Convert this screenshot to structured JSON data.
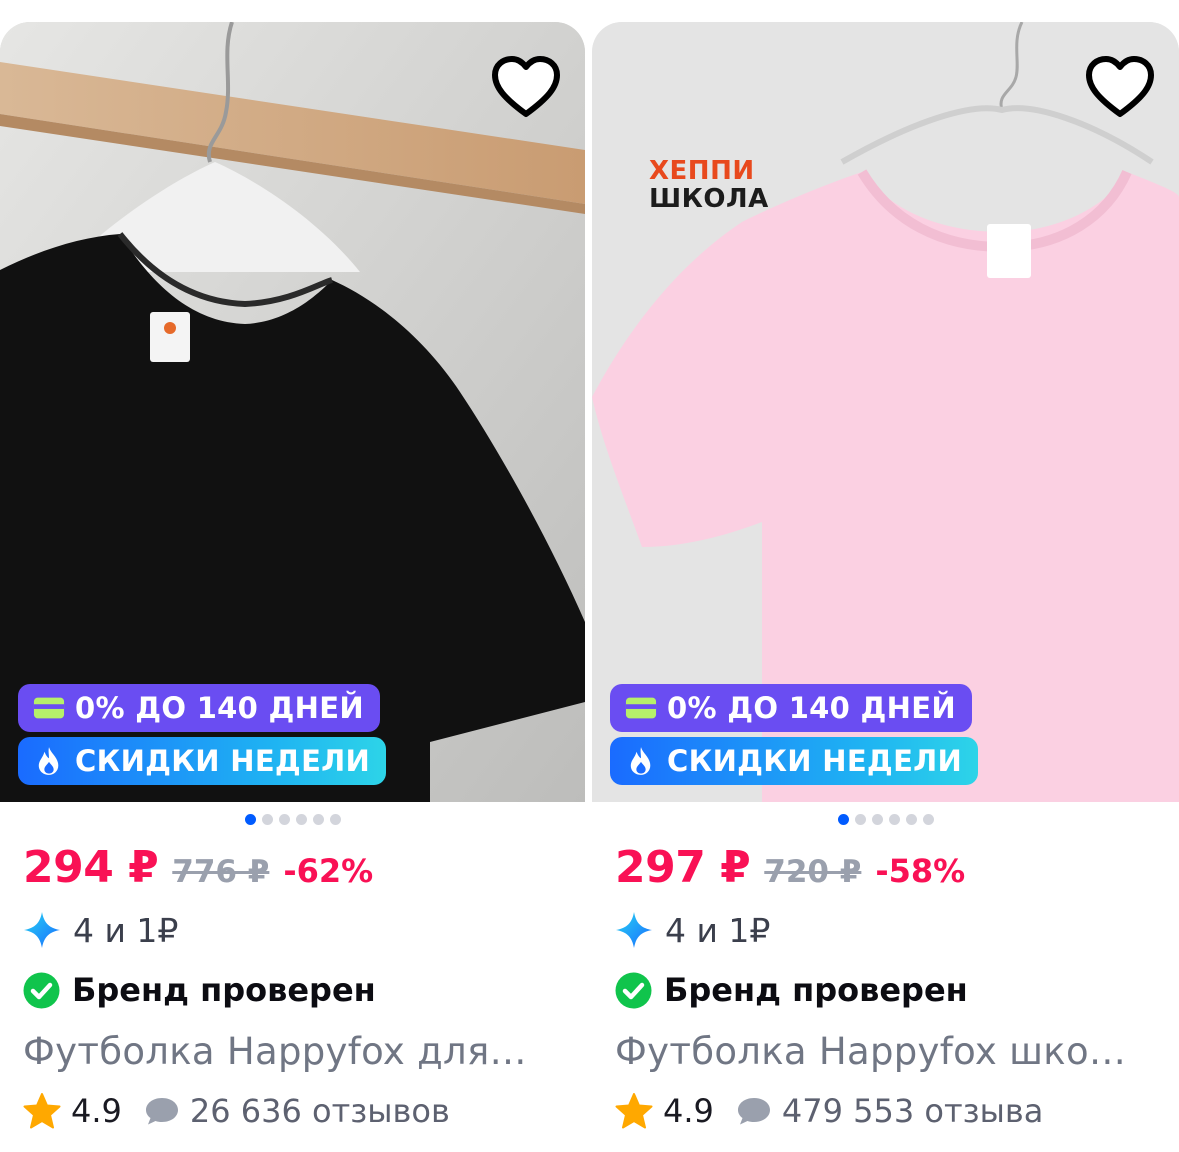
{
  "colors": {
    "price": "#f91155",
    "old_price": "#9aa0ad",
    "credit_badge": "#6a4df2",
    "sale_badge": "#1a6bff",
    "dot_active": "#005bff",
    "check": "#10c44c",
    "star": "#ffa800"
  },
  "products": [
    {
      "image_alt": "black t-shirt on hanger",
      "favorite_icon": "heart-outline-icon",
      "badges": {
        "credit": "0% ДО 140 ДНЕЙ",
        "sale": "СКИДКИ НЕДЕЛИ"
      },
      "gallery": {
        "total": 6,
        "active": 1
      },
      "price": {
        "current": "294 ₽",
        "old": "776 ₽",
        "discount": "-62%"
      },
      "bonus": "4 и 1₽",
      "brand_verified": "Бренд проверен",
      "title": "Футболка Happyfox для…",
      "rating": "4.9",
      "reviews": "26 636 отзывов"
    },
    {
      "image_alt": "pink t-shirt on hanger",
      "favorite_icon": "heart-outline-icon",
      "logo": {
        "line1": "ХЕППИ",
        "line2": "ШКОЛА"
      },
      "badges": {
        "credit": "0% ДО 140 ДНЕЙ",
        "sale": "СКИДКИ НЕДЕЛИ"
      },
      "gallery": {
        "total": 6,
        "active": 1
      },
      "price": {
        "current": "297 ₽",
        "old": "720 ₽",
        "discount": "-58%"
      },
      "bonus": "4 и 1₽",
      "brand_verified": "Бренд проверен",
      "title": "Футболка Happyfox шко…",
      "rating": "4.9",
      "reviews": "479 553 отзыва"
    }
  ]
}
